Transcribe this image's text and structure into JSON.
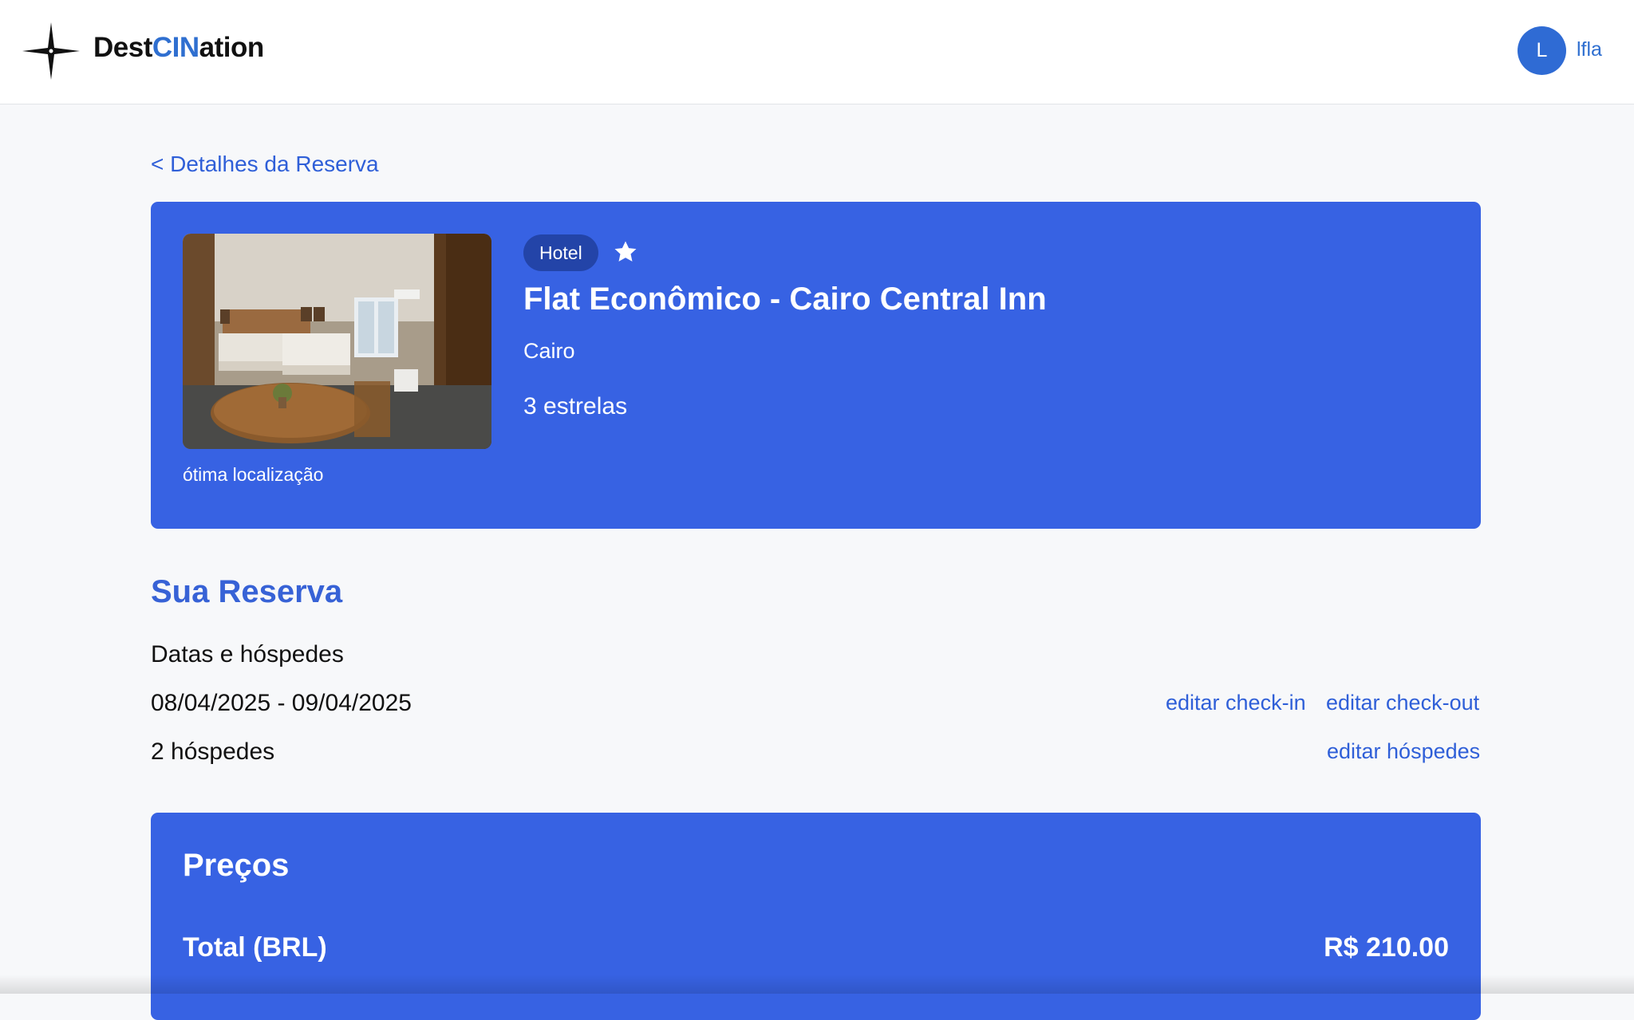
{
  "header": {
    "logo_part1": "Dest",
    "logo_accent": "CIN",
    "logo_part2": "ation",
    "logo_icon": "compass-star-icon",
    "avatar_initial": "L",
    "user_name": "lfla"
  },
  "breadcrumb": {
    "back_label": "< Detalhes da Reserva"
  },
  "hotel": {
    "type_badge": "Hotel",
    "favorite_icon": "star-icon",
    "name": "Flat Econômico - Cairo Central Inn",
    "city": "Cairo",
    "stars_label": "3 estrelas",
    "photo_caption": "ótima localização"
  },
  "reservation": {
    "title": "Sua Reserva",
    "subtitle": "Datas e hóspedes",
    "dates": "08/04/2025 - 09/04/2025",
    "guests": "2 hóspedes",
    "edit_checkin": "editar check-in",
    "edit_checkout": "editar check-out",
    "edit_guests": "editar hóspedes"
  },
  "prices": {
    "title": "Preços",
    "total_label": "Total (BRL)",
    "total_value": "R$ 210.00"
  },
  "colors": {
    "primary": "#3762e3",
    "link": "#2f5fd8",
    "badge": "#2344a8",
    "avatar": "#2f6bd4",
    "background": "#f7f8fa"
  }
}
